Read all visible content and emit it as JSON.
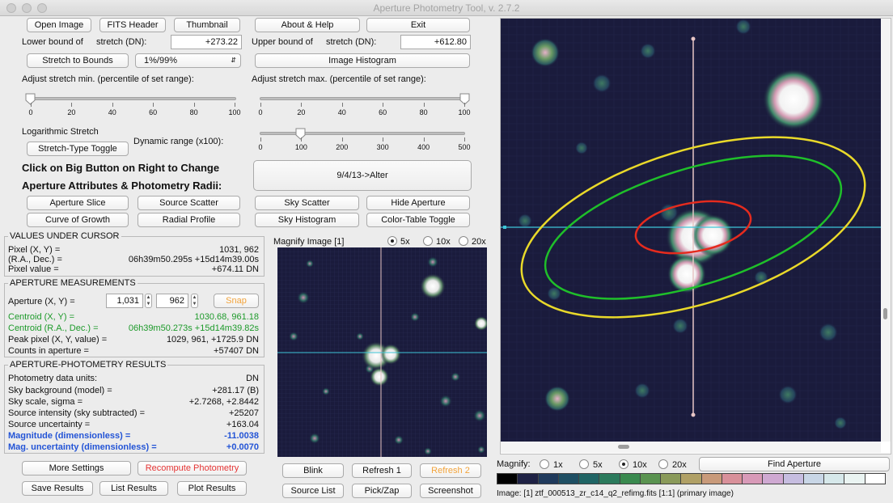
{
  "app": {
    "title": "Aperture Photometry Tool, v. 2.7.2"
  },
  "toolbar": {
    "open_image": "Open Image",
    "fits_header": "FITS Header",
    "thumbnail": "Thumbnail",
    "about_help": "About & Help",
    "exit": "Exit"
  },
  "stretch": {
    "lower_label": "Lower bound of",
    "lower_sub": "stretch (DN):",
    "lower_value": "+273.22",
    "upper_label": "Upper bound of",
    "upper_sub": "stretch (DN):",
    "upper_value": "+612.80",
    "stretch_to_bounds": "Stretch to Bounds",
    "percent_select": "1%/99%",
    "image_histogram": "Image Histogram",
    "adjust_min_label": "Adjust stretch min. (percentile of set range):",
    "adjust_max_label": "Adjust stretch max. (percentile of set range):",
    "min_ticks": [
      "0",
      "20",
      "40",
      "60",
      "80",
      "100"
    ],
    "max_ticks": [
      "0",
      "20",
      "40",
      "60",
      "80",
      "100"
    ],
    "min_value": 0,
    "max_value": 100,
    "log_stretch_label": "Logarithmic Stretch",
    "stretch_type_toggle": "Stretch-Type Toggle",
    "dynamic_range_label": "Dynamic range (x100):",
    "dynamic_ticks": [
      "0",
      "100",
      "200",
      "300",
      "400",
      "500"
    ],
    "dynamic_value": 100
  },
  "instructions": {
    "line1": "Click on Big Button on Right to Change",
    "line2": "Aperture Attributes & Photometry Radii:",
    "big_button": "9/4/13->Alter"
  },
  "actions": {
    "aperture_slice": "Aperture Slice",
    "source_scatter": "Source Scatter",
    "sky_scatter": "Sky Scatter",
    "hide_aperture": "Hide Aperture",
    "curve_of_growth": "Curve of Growth",
    "radial_profile": "Radial Profile",
    "sky_histogram": "Sky Histogram",
    "color_table_toggle": "Color-Table Toggle"
  },
  "cursor": {
    "header": "VALUES UNDER CURSOR",
    "pixel_label": "Pixel (X, Y) =",
    "pixel_value": "1031, 962",
    "radec_label": "(R.A., Dec.) =",
    "radec_value": "06h39m50.295s +15d14m39.00s",
    "pixval_label": "Pixel value =",
    "pixval_value": "+674.11 DN"
  },
  "measurements": {
    "header": "APERTURE MEASUREMENTS",
    "aperture_label": "Aperture (X, Y) =",
    "aperture_x": "1,031",
    "aperture_y": "962",
    "snap": "Snap",
    "centroid_label": "Centroid (X, Y) =",
    "centroid_value": "1030.68, 961.18",
    "centroid_radec_label": "Centroid (R.A., Dec.) =",
    "centroid_radec_value": "06h39m50.273s +15d14m39.82s",
    "peak_label": "Peak pixel (X, Y, value) =",
    "peak_value": "1029, 961, +1725.9 DN",
    "counts_label": "Counts in aperture =",
    "counts_value": "+57407 DN"
  },
  "results": {
    "header": "APERTURE-PHOTOMETRY RESULTS",
    "units_label": "Photometry data units:",
    "units_value": "DN",
    "sky_bg_label": "Sky background (model) =",
    "sky_bg_value": "+281.17 (B)",
    "sky_scale_label": "Sky scale, sigma =",
    "sky_scale_value": "+2.7268, +2.8442",
    "src_int_label": "Source intensity (sky subtracted)  =",
    "src_int_value": "+25207",
    "src_unc_label": "Source uncertainty =",
    "src_unc_value": "+163.04",
    "mag_label": "Magnitude (dimensionless) =",
    "mag_value": "-11.0038",
    "mag_unc_label": "Mag. uncertainty (dimensionless) =",
    "mag_unc_value": "+0.0070"
  },
  "bottom": {
    "more_settings": "More Settings",
    "recompute": "Recompute Photometry",
    "save_results": "Save Results",
    "list_results": "List Results",
    "plot_results": "Plot Results",
    "blink": "Blink",
    "refresh1": "Refresh 1",
    "refresh2": "Refresh 2",
    "source_list": "Source List",
    "pick_zap": "Pick/Zap",
    "screenshot": "Screenshot"
  },
  "magnify_small": {
    "label": "Magnify Image [1]",
    "options": [
      "5x",
      "10x",
      "20x"
    ],
    "selected": "5x"
  },
  "magnify_main": {
    "label": "Magnify:",
    "options": [
      "1x",
      "5x",
      "10x",
      "20x"
    ],
    "selected": "10x",
    "find_aperture": "Find Aperture"
  },
  "status": {
    "image_info": "Image: [1]  ztf_000513_zr_c14_q2_refimg.fits [1:1] (primary image)"
  },
  "colors": {
    "sky": "#1a1b3c",
    "aperture": "#e52b1e",
    "inner_annulus": "#1fbf2a",
    "outer_annulus": "#e9d92a",
    "crosshair": "#e8c6c6",
    "crosshair_h": "#3ec6d8",
    "colorbar": [
      "#000000",
      "#1e2144",
      "#203a5c",
      "#1f4f63",
      "#1f6464",
      "#2b7a5c",
      "#3a8a4f",
      "#5a9350",
      "#8a9a5a",
      "#b0a066",
      "#c89a7a",
      "#d8909a",
      "#d89ab8",
      "#cfa9d2",
      "#c6bde0",
      "#c8d6e6",
      "#d6e8ea",
      "#eaf4f2",
      "#ffffff"
    ]
  }
}
